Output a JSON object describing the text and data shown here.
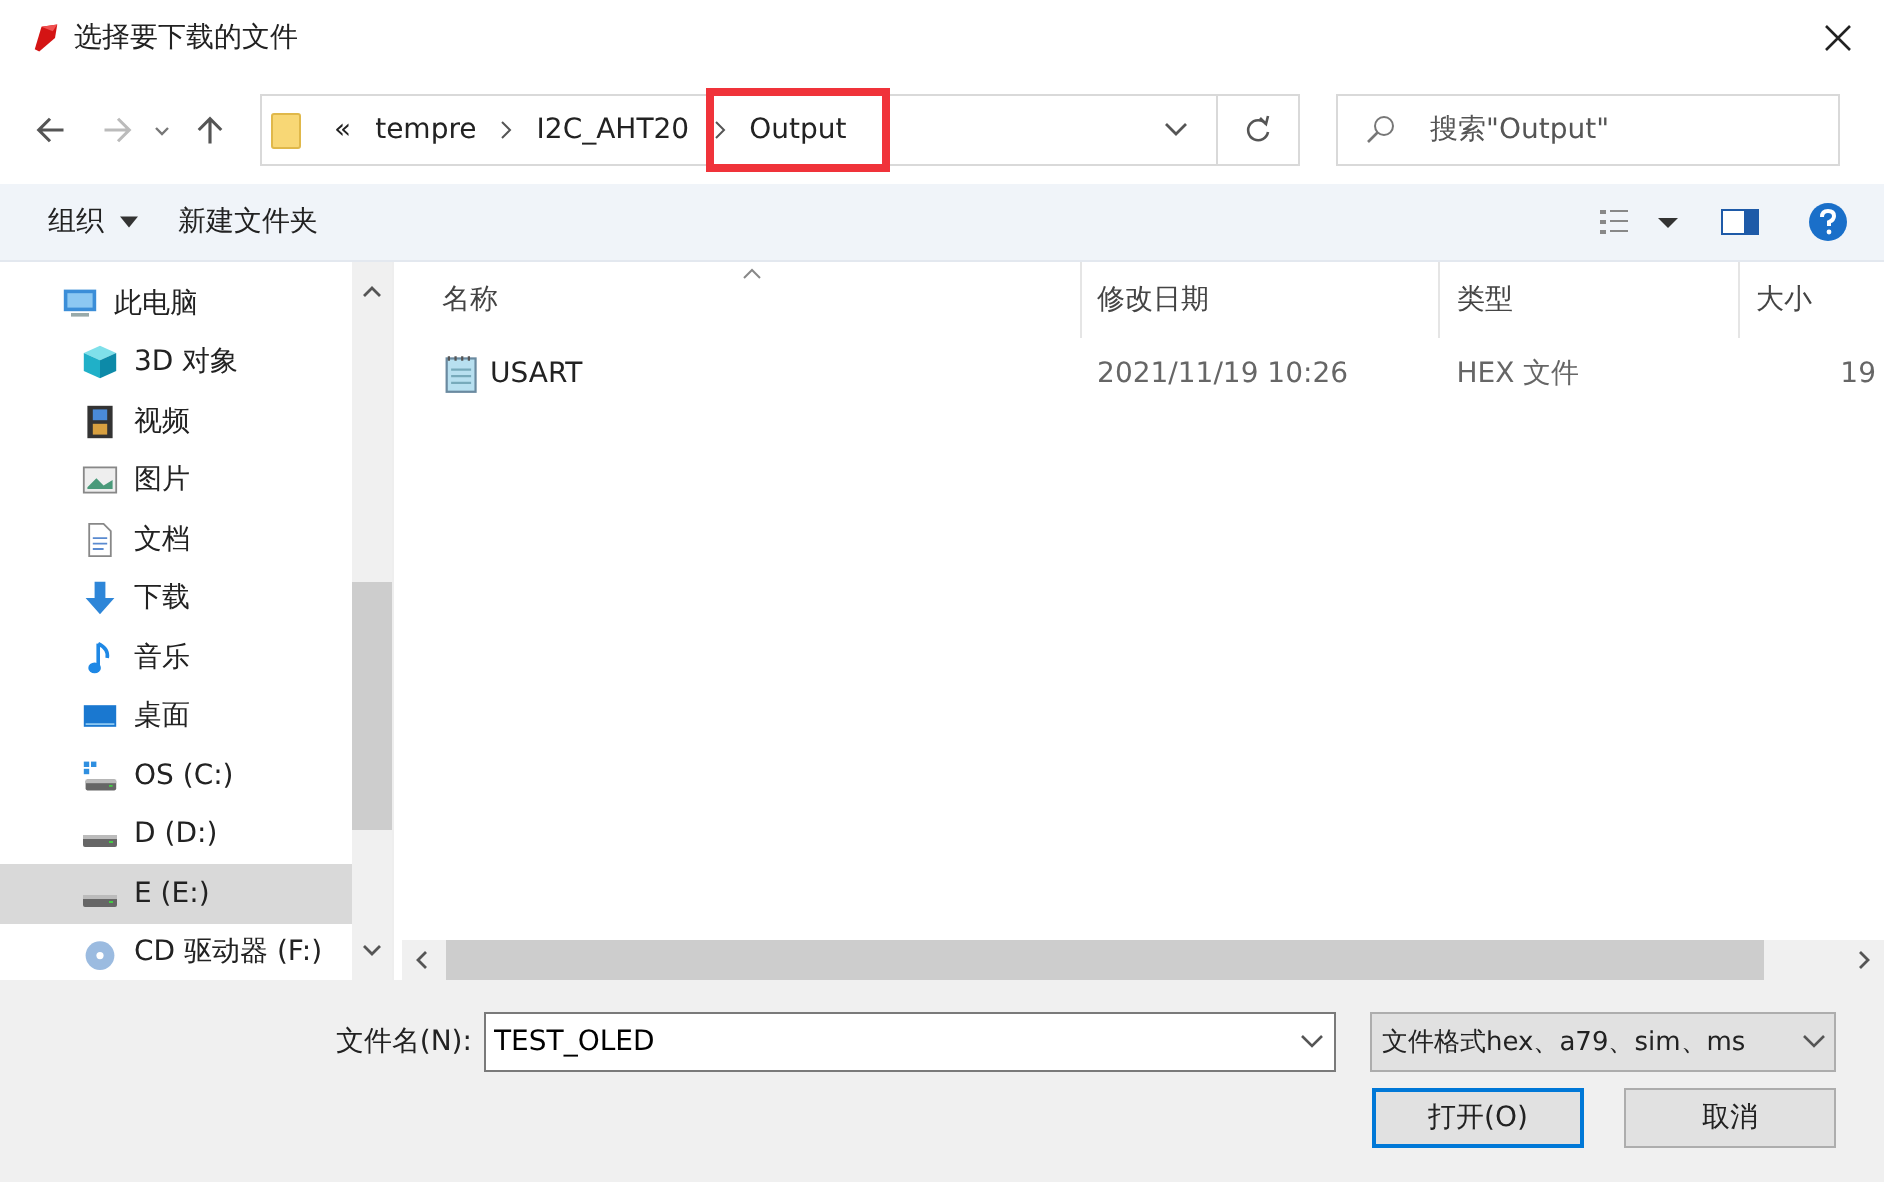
{
  "window": {
    "title": "选择要下载的文件"
  },
  "address_bar": {
    "overflow": "«",
    "crumbs": [
      {
        "label": "tempre",
        "highlighted": false
      },
      {
        "label": "I2C_AHT20",
        "highlighted": false
      },
      {
        "label": "Output",
        "highlighted": true
      }
    ]
  },
  "search": {
    "placeholder": "搜索\"Output\""
  },
  "toolbar": {
    "organize": "组织",
    "new_folder": "新建文件夹"
  },
  "sidebar": {
    "items": [
      {
        "label": "此电脑",
        "selected": false,
        "children": [
          {
            "label": "3D 对象",
            "selected": false
          },
          {
            "label": "视频",
            "selected": false
          },
          {
            "label": "图片",
            "selected": false
          },
          {
            "label": "文档",
            "selected": false
          },
          {
            "label": "下载",
            "selected": false
          },
          {
            "label": "音乐",
            "selected": false
          },
          {
            "label": "桌面",
            "selected": false
          },
          {
            "label": "OS (C:)",
            "selected": false
          },
          {
            "label": "D (D:)",
            "selected": false
          },
          {
            "label": "E (E:)",
            "selected": true
          },
          {
            "label": "CD 驱动器 (F:)",
            "selected": false
          }
        ]
      }
    ]
  },
  "table": {
    "columns": [
      "名称",
      "修改日期",
      "类型",
      "大小"
    ],
    "rows": [
      {
        "name": "USART",
        "modified": "2021/11/19 10:26",
        "type": "HEX 文件",
        "size": "19"
      }
    ]
  },
  "footer": {
    "filename_label": "文件名(N):",
    "filename": "TEST_OLED",
    "filter": "文件格式hex、a79、sim、ms",
    "buttons": [
      {
        "label": "打开(O)",
        "default": true
      },
      {
        "label": "取消",
        "default": false
      }
    ]
  }
}
